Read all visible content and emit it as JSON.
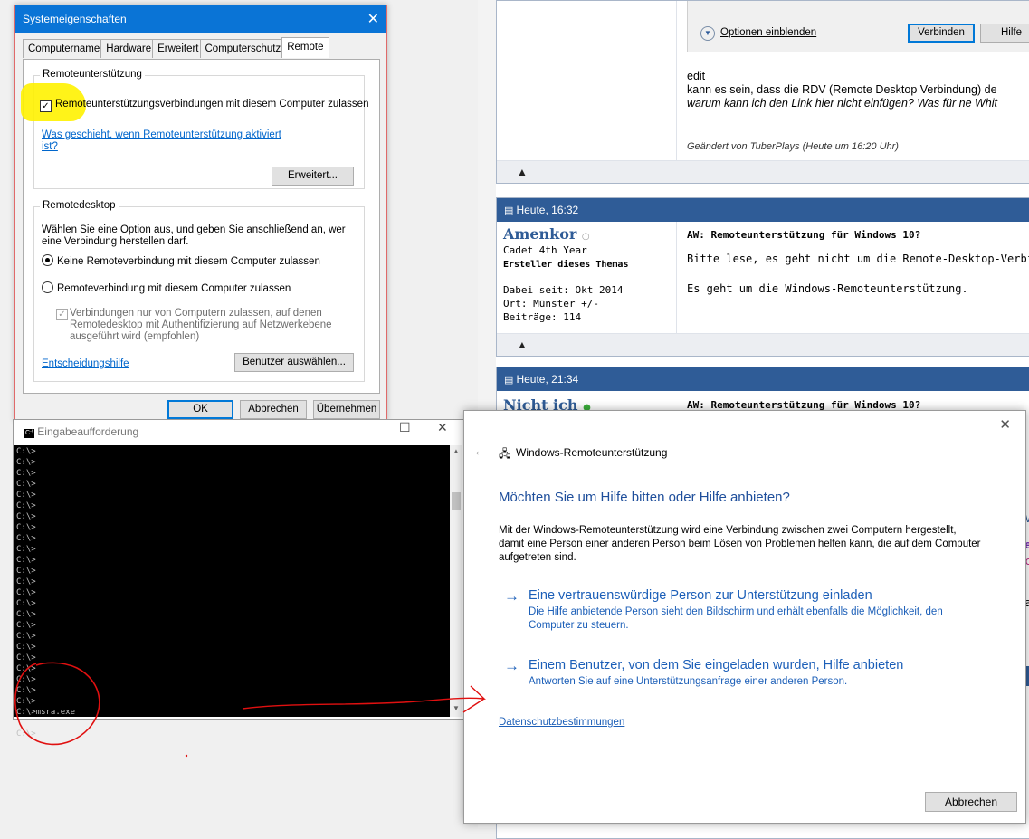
{
  "forum": {
    "options_label": "Optionen einblenden",
    "connect_label": "Verbinden",
    "help_label": "Hilfe",
    "edit_lines": [
      "edit",
      "kann es sein, dass die RDV (Remote Desktop Verbindung) de",
      "warum kann ich den Link hier nicht einfügen? Was für ne Whit"
    ],
    "edited_by": "Geändert von TuberPlays (Heute um 16:20 Uhr)",
    "post1": {
      "time": "Heute, 16:32",
      "user": "Amenkor",
      "rank": "Cadet 4th Year",
      "role": "Ersteller dieses Themas",
      "joined": "Dabei seit: Okt 2014",
      "location": "Ort: Münster +/-",
      "posts": "Beiträge: 114",
      "subject": "AW: Remoteunterstützung für Windows 10?",
      "line1": "Bitte lese, es geht nicht um die Remote-Desktop-Verbindung",
      "line2": "Es geht um die Windows-Remoteunterstützung."
    },
    "post2": {
      "time": "Heute, 21:34",
      "user": "Nicht ich",
      "subject": "AW: Remoteunterstützung für Windows 10?"
    },
    "fragments": [
      "TV",
      "We",
      "uc",
      "ea"
    ]
  },
  "sysprops": {
    "title": "Systemeigenschaften",
    "tabs": [
      "Computername",
      "Hardware",
      "Erweitert",
      "Computerschutz",
      "Remote"
    ],
    "ra_group": "Remoteunterstützung",
    "ra_checkbox": "Remoteunterstützungsverbindungen mit diesem Computer zulassen",
    "ra_link_1": "Was geschieht, wenn Remoteunterstützung aktiviert",
    "ra_link_2": "ist?",
    "advanced_button": "Erweitert...",
    "rd_group": "Remotedesktop",
    "rd_intro_1": "Wählen Sie eine Option aus, und geben Sie anschließend an, wer",
    "rd_intro_2": "eine Verbindung herstellen darf.",
    "rd_option_none": "Keine Remoteverbindung mit diesem Computer zulassen",
    "rd_option_allow": "Remoteverbindung mit diesem Computer zulassen",
    "nla_1": "Verbindungen nur von Computern zulassen, auf denen",
    "nla_2": "Remotedesktop mit Authentifizierung auf Netzwerkebene",
    "nla_3": "ausgeführt wird (empfohlen)",
    "decision_link": "Entscheidungshilfe",
    "select_users_button": "Benutzer auswählen...",
    "ok": "OK",
    "cancel": "Abbrechen",
    "apply": "Übernehmen"
  },
  "cmd": {
    "title": "Eingabeaufforderung",
    "icon_text": "C:\\",
    "console": "C:\\>\nC:\\>\nC:\\>\nC:\\>\nC:\\>\nC:\\>\nC:\\>\nC:\\>\nC:\\>\nC:\\>\nC:\\>\nC:\\>\nC:\\>\nC:\\>\nC:\\>\nC:\\>\nC:\\>\nC:\\>\nC:\\>\nC:\\>\nC:\\>\nC:\\>\nC:\\>\nC:\\>\nC:\\>msra.exe\n\nC:\\>"
  },
  "msra": {
    "title": "Windows-Remoteunterstützung",
    "heading": "Möchten Sie um Hilfe bitten oder Hilfe anbieten?",
    "intro_1": "Mit der Windows-Remoteunterstützung wird eine Verbindung zwischen zwei Computern hergestellt,",
    "intro_2": "damit eine Person einer anderen Person beim Lösen von Problemen helfen kann, die auf dem Computer",
    "intro_3": "aufgetreten sind.",
    "option1_title": "Eine vertrauenswürdige Person zur Unterstützung einladen",
    "option1_desc_1": "Die Hilfe anbietende Person sieht den Bildschirm und erhält ebenfalls die Möglichkeit, den",
    "option1_desc_2": "Computer zu steuern.",
    "option2_title": "Einem Benutzer, von dem Sie eingeladen wurden, Hilfe anbieten",
    "option2_desc": "Antworten Sie auf eine Unterstützungsanfrage einer anderen Person.",
    "privacy_link": "Datenschutzbestimmungen",
    "cancel": "Abbrechen"
  },
  "colors": {
    "titlebar_blue": "#0a74d6",
    "forum_header_blue": "#2f5c97",
    "link_blue": "#0066cc",
    "annotation_red": "#e01010",
    "highlight_yellow": "#fff200"
  }
}
